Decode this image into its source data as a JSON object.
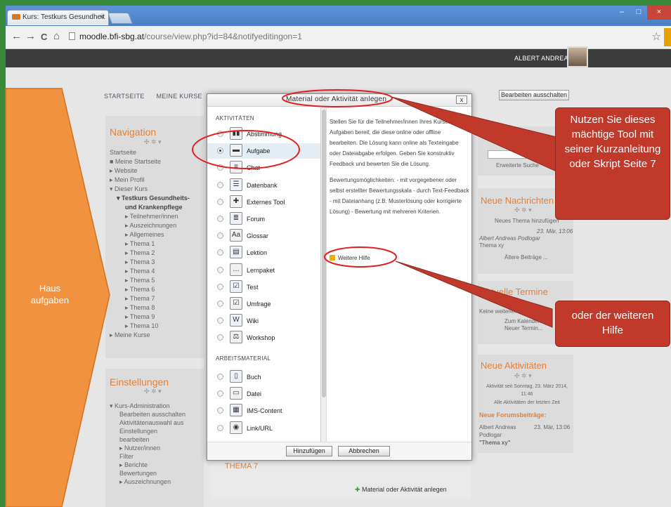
{
  "browser": {
    "tab_title": "Kurs: Testkurs Gesundheit",
    "tab_close": "×",
    "url_domain": "moodle.bfi-sbg.at",
    "url_path": "/course/view.php?id=84&notifyeditingon=1",
    "back": "←",
    "forward": "→",
    "reload": "C",
    "home": "⌂",
    "star": "☆",
    "win_min": "–",
    "win_max": "□",
    "win_close": "×"
  },
  "header": {
    "user_name": "ALBERT ANDREAS",
    "caret": "▾"
  },
  "topnav": {
    "home": "STARTSEITE",
    "my_courses": "MEINE KURSE"
  },
  "edit_button": "Bearbeiten ausschalten",
  "navigation": {
    "title": "Navigation",
    "controls": "✣ ✲ ▾",
    "items": [
      "Startseite",
      "■ Meine Startseite",
      "▸ Website",
      "▸ Mein Profil",
      "▾ Dieser Kurs",
      "▾ Testkurs Gesundheits-",
      "und Krankenpflege",
      "▸ Teilnehmer/innen",
      "▸ Auszeichnungen",
      "▸ Allgemeines",
      "▸ Thema 1",
      "▸ Thema 2",
      "▸ Thema 3",
      "▸ Thema 4",
      "▸ Thema 5",
      "▸ Thema 6",
      "▸ Thema 7",
      "▸ Thema 8",
      "▸ Thema 9",
      "▸ Thema 10",
      "▸ Meine Kurse"
    ]
  },
  "settings": {
    "title": "Einstellungen",
    "controls": "✣ ✲ ▾",
    "items": [
      "▾ Kurs-Administration",
      "Bearbeiten ausschalten",
      "Aktivitätenauswahl aus",
      "Einstellungen",
      "bearbeiten",
      "▸ Nutzer/innen",
      "Filter",
      "▸ Berichte",
      "Bewertungen",
      "▸ Auszeichnungen"
    ]
  },
  "modal": {
    "title": "Material oder Aktivität anlegen",
    "close": "x",
    "section_activities": "AKTIVITÄTEN",
    "section_resources": "ARBEITSMATERIAL",
    "activities": [
      {
        "label": "Abstimmung",
        "icon": "▮▮"
      },
      {
        "label": "Aufgabe",
        "icon": "▬"
      },
      {
        "label": "Chat",
        "icon": "≡"
      },
      {
        "label": "Datenbank",
        "icon": "☰"
      },
      {
        "label": "Externes Tool",
        "icon": "✚"
      },
      {
        "label": "Forum",
        "icon": "≣"
      },
      {
        "label": "Glossar",
        "icon": "Aa"
      },
      {
        "label": "Lektion",
        "icon": "▤"
      },
      {
        "label": "Lernpaket",
        "icon": "…"
      },
      {
        "label": "Test",
        "icon": "☑"
      },
      {
        "label": "Umfrage",
        "icon": "☑"
      },
      {
        "label": "Wiki",
        "icon": "W"
      },
      {
        "label": "Workshop",
        "icon": "⚖"
      }
    ],
    "resources": [
      {
        "label": "Buch",
        "icon": "▯"
      },
      {
        "label": "Datei",
        "icon": "▭"
      },
      {
        "label": "IMS-Content",
        "icon": "▦"
      },
      {
        "label": "Link/URL",
        "icon": "◉"
      }
    ],
    "help_p1": "Stellen Sie für die Teilnehmer/innen Ihres Kurses Aufgaben bereit, die diese online oder offline bearbeiten. Die Lösung kann online als Texteingabe oder Dateiabgabe erfolgen. Geben Sie konstruktiv Feedback und bewerten Sie die Lösung.",
    "help_p2": "Bewertungsmöglichkeiten: - mit vorgegebener oder selbst erstellter Bewertungsskala - durch Text-Feedback - mit Dateianhang (z.B. Musterlösung oder korrigierte Lösung) - Bewertung mit mehreren Kriterien.",
    "more_help": "Weitere Hilfe",
    "add": "Hinzufügen",
    "cancel": "Abbrechen"
  },
  "right": {
    "search_btn": "Erweiterte Suche",
    "news_title": "Neue Nachrichten",
    "news_controls": "✣ ✲ ▾",
    "news_add": "Neues Thema hinzufügen",
    "news_date": "23. Mär, 13:06",
    "news_author": "Albert Andreas Podlogar",
    "news_topic": "Thema xy",
    "news_older": "Ältere Beiträge ...",
    "events_title": "Aktuelle Termine",
    "events_none": "Keine weiteren Termine",
    "events_cal": "Zum Kalender...",
    "events_new": "Neuer Termin...",
    "act_title": "Neue Aktivitäten",
    "act_controls": "✣ ✲ ▾",
    "act_since": "Aktivität seit Sonntag, 23. März 2014, 11:46",
    "act_all": "Alle Aktivitäten der letzten Zeit",
    "act_forum": "Neue Forumsbeiträge:",
    "act_author": "Albert Andreas Podlogar",
    "act_date": "23. Mär, 13:06",
    "act_topic": "\"Thema xy\""
  },
  "main": {
    "topic_title": "THEMA 7",
    "add_activity": "Material oder Aktivität anlegen"
  },
  "overlays": {
    "left_text": "Haus aufgaben",
    "right_1": "Nutzen Sie dieses mächtige Tool mit seiner Kurzanleitung oder Skript Seite 7",
    "right_2": "oder der weiteren Hilfe"
  },
  "colors": {
    "frame_green": "#39893a",
    "orange_callout": "#f0923f",
    "red_callout": "#c0392b",
    "moodle_orange": "#e0803a"
  }
}
